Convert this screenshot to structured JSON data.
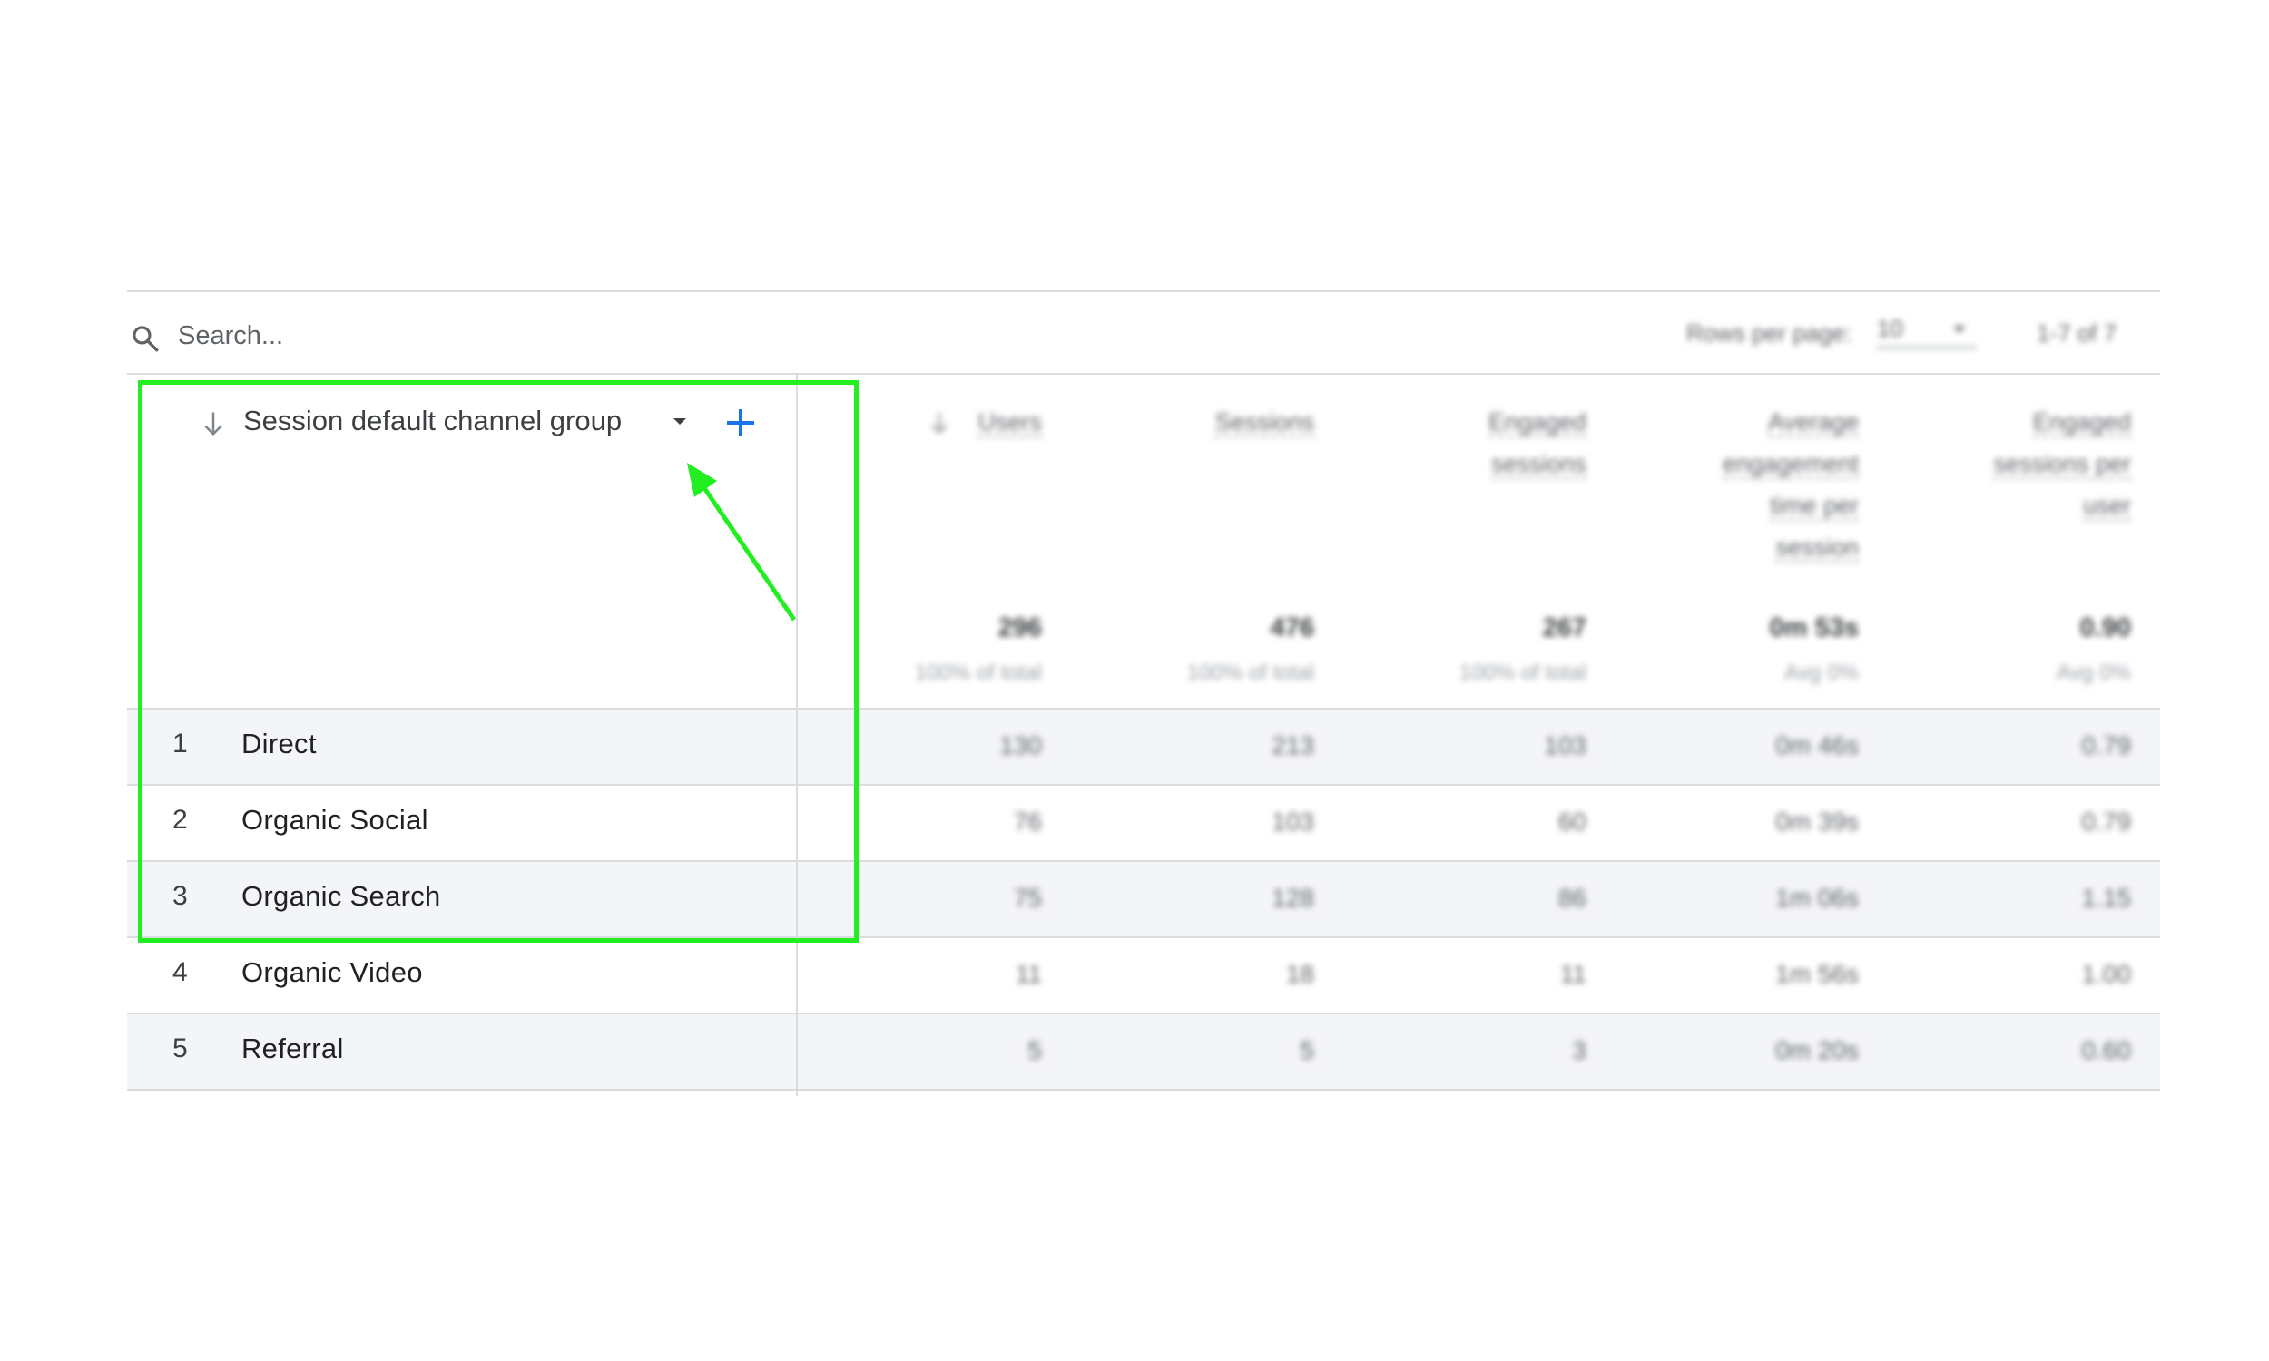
{
  "search": {
    "placeholder": "Search..."
  },
  "dimension": {
    "header": "Session default channel group"
  },
  "rows": [
    {
      "num": "1",
      "label": "Direct"
    },
    {
      "num": "2",
      "label": "Organic Social"
    },
    {
      "num": "3",
      "label": "Organic Search"
    },
    {
      "num": "4",
      "label": "Organic Video"
    },
    {
      "num": "5",
      "label": "Referral"
    }
  ],
  "pagination": {
    "rows_per_page_label": "Rows per page:",
    "rows_per_page_value": "10",
    "range": "1-7 of 7"
  },
  "metrics": [
    {
      "header": [
        "Users"
      ],
      "total": "296",
      "sub": "100% of total",
      "values": [
        "130",
        "76",
        "75",
        "11",
        "5"
      ]
    },
    {
      "header": [
        "Sessions"
      ],
      "total": "476",
      "sub": "100% of total",
      "values": [
        "213",
        "103",
        "128",
        "18",
        "5"
      ]
    },
    {
      "header": [
        "Engaged",
        "sessions"
      ],
      "total": "267",
      "sub": "100% of total",
      "values": [
        "103",
        "60",
        "86",
        "11",
        "3"
      ]
    },
    {
      "header": [
        "Average",
        "engagement",
        "time per",
        "session"
      ],
      "total": "0m 53s",
      "sub": "Avg 0%",
      "values": [
        "0m 46s",
        "0m 39s",
        "1m 06s",
        "1m 56s",
        "0m 20s"
      ]
    },
    {
      "header": [
        "Engaged",
        "sessions per",
        "user"
      ],
      "total": "0.90",
      "sub": "Avg 0%",
      "values": [
        "0.79",
        "0.79",
        "1.15",
        "1.00",
        "0.60"
      ]
    }
  ],
  "colors": {
    "highlight": "#22ee22",
    "accent": "#1a73e8"
  }
}
